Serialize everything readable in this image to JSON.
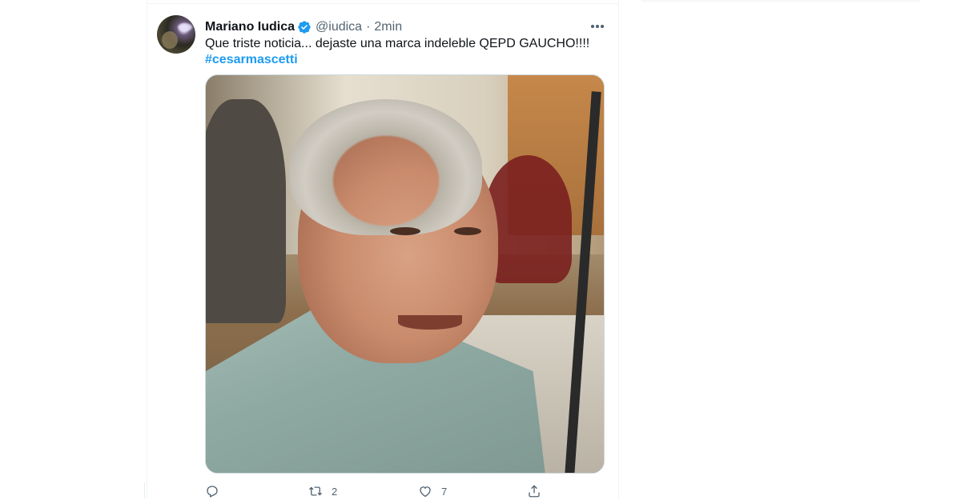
{
  "tweet": {
    "display_name": "Mariano Iudica",
    "handle": "@iudica",
    "separator": "·",
    "time": "2min",
    "text": "Que triste noticia... dejaste una marca indeleble QEPD GAUCHO!!!!",
    "hashtag": "#cesarmascetti",
    "retweets": "2",
    "likes": "7"
  },
  "icons": {
    "verified": "verified-badge-icon",
    "more": "more-icon",
    "reply": "reply-icon",
    "retweet": "retweet-icon",
    "like": "like-icon",
    "share": "share-icon"
  },
  "colors": {
    "accent": "#1d9bf0",
    "secondary_text": "#536471",
    "primary_text": "#0f1419"
  }
}
